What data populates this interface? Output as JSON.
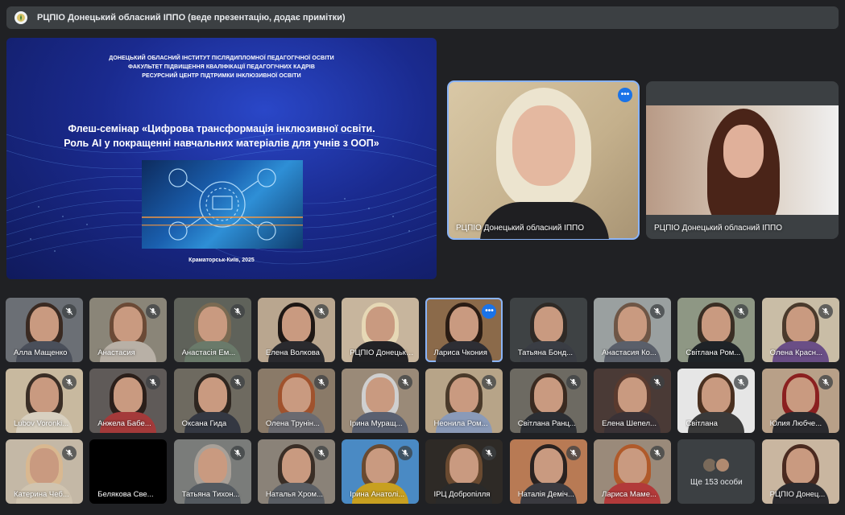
{
  "topbar": {
    "title": "РЦПІО Донецький обласний ІППО (веде презентацію, додає примітки)",
    "logo_icon": "org-logo-icon"
  },
  "slide": {
    "header_lines": [
      "ДОНЕЦЬКИЙ ОБЛАСНИЙ ІНСТИТУТ ПІСЛЯДИПЛОМНОЇ ПЕДАГОГІЧНОЇ ОСВІТИ",
      "ФАКУЛЬТЕТ ПІДВИЩЕННЯ КВАЛІФІКАЦІЇ ПЕДАГОГІЧНИХ КАДРІВ",
      "РЕСУРСНИЙ ЦЕНТР ПІДТРИМКИ ІНКЛЮЗИВНОЇ ОСВІТИ"
    ],
    "heading_lines": [
      "Флеш-семінар «Цифрова трансформація інклюзивної освіти.",
      "Роль AI у покращенні навчальних матеріалів для учнів з ООП»"
    ],
    "footer": "Краматорськ-Київ, 2025"
  },
  "main_tiles": [
    {
      "label": "РЦПІО Донецький обласний ІППО",
      "active": true
    },
    {
      "label": "РЦПІО Донецький обласний ІППО",
      "active": false
    }
  ],
  "participants": [
    {
      "name": "Алла Мащенко",
      "muted": true,
      "bg": "#6b6f75",
      "hair": "#3a2a22",
      "shirt": "#4a4f5a"
    },
    {
      "name": "Анастасия",
      "muted": true,
      "bg": "#8a8578",
      "hair": "#6b4a36",
      "shirt": "#b8b0a6"
    },
    {
      "name": "Анастасія Ем...",
      "muted": true,
      "bg": "#5f625a",
      "hair": "#7a6a52",
      "shirt": "#6a7a6a"
    },
    {
      "name": "Елена Волкова",
      "muted": true,
      "bg": "#b9a68f",
      "hair": "#1e1714",
      "shirt": "#2a2a2e"
    },
    {
      "name": "РЦПІО Донецький ...",
      "muted": false,
      "bg": "#c7b59d",
      "hair": "#e6d8b5",
      "shirt": "#222225"
    },
    {
      "name": "Лариса Чкония",
      "muted": false,
      "active": true,
      "bg": "#8b6a4a",
      "hair": "#2a1c14",
      "shirt": "#2e2e34"
    },
    {
      "name": "Татьяна Бонд...",
      "muted": false,
      "bg": "#3e4244",
      "hair": "#2f2a26",
      "shirt": "#3a3d44"
    },
    {
      "name": "Анастасия Ко...",
      "muted": true,
      "bg": "#9aa0a0",
      "hair": "#6e5646",
      "shirt": "#5a5f6a"
    },
    {
      "name": "Світлана Ром...",
      "muted": true,
      "bg": "#8e9784",
      "hair": "#3a2e24",
      "shirt": "#1f2327"
    },
    {
      "name": "Олена Красн...",
      "muted": true,
      "bg": "#c9bda6",
      "hair": "#4a3a2c",
      "shirt": "#6a4e86"
    },
    {
      "name": "Lubov Voronki...",
      "muted": true,
      "bg": "#c8b99f",
      "hair": "#3a2e26",
      "shirt": "#d8d0c0"
    },
    {
      "name": "Анжела Бабе...",
      "muted": true,
      "bg": "#5f5a58",
      "hair": "#2b1f1a",
      "shirt": "#a43a3a"
    },
    {
      "name": "Оксана Гида",
      "muted": true,
      "bg": "#6e6a60",
      "hair": "#2e2620",
      "shirt": "#343842"
    },
    {
      "name": "Олена Трунін...",
      "muted": true,
      "bg": "#8a7a68",
      "hair": "#a0522d",
      "shirt": "#6a6a70"
    },
    {
      "name": "Ірина Муращ...",
      "muted": true,
      "bg": "#9a8a78",
      "hair": "#cfcfcf",
      "shirt": "#5a6070"
    },
    {
      "name": "Неонила Ром...",
      "muted": true,
      "bg": "#b7a488",
      "hair": "#4a3a2a",
      "shirt": "#8a9ab8"
    },
    {
      "name": "Світлана Ранц...",
      "muted": true,
      "bg": "#6d6a62",
      "hair": "#3a2a20",
      "shirt": "#2b2e33"
    },
    {
      "name": "Елена Шепел...",
      "muted": true,
      "bg": "#4a3a36",
      "hair": "#5a3a2e",
      "shirt": "#3a3236"
    },
    {
      "name": "Світлана",
      "muted": true,
      "bg": "#e6e6e6",
      "hair": "#4a3020",
      "shirt": "#3a3a3a"
    },
    {
      "name": "Юлия Любче...",
      "muted": true,
      "bg": "#b8a088",
      "hair": "#8b2020",
      "shirt": "#2a2a2e"
    },
    {
      "name": "Катерина Чеб...",
      "muted": true,
      "bg": "#c4b8a6",
      "hair": "#d9b890",
      "shirt": "#d0c4b0"
    },
    {
      "name": "Белякова Све...",
      "muted": false,
      "bg": "#000000",
      "hair": "#000000",
      "shirt": "#000000",
      "video_off": true
    },
    {
      "name": "Татьяна Тихон...",
      "muted": true,
      "bg": "#7a7c7a",
      "hair": "#a8a098",
      "shirt": "#545a60"
    },
    {
      "name": "Наталья Хром...",
      "muted": true,
      "bg": "#8a8278",
      "hair": "#3a2e26",
      "shirt": "#5a5e64"
    },
    {
      "name": "Ірина Анатолі...",
      "muted": true,
      "bg": "#4a8ac4",
      "hair": "#6a4a30",
      "shirt": "#c8a020"
    },
    {
      "name": "ІРЦ Добропілля",
      "muted": true,
      "bg": "#2e2a26",
      "hair": "#6a4a30",
      "shirt": "#2a2a2a"
    },
    {
      "name": "Наталія Деміч...",
      "muted": true,
      "bg": "#b87a54",
      "hair": "#2a2220",
      "shirt": "#3a3a40"
    },
    {
      "name": "Лариса Маме...",
      "muted": true,
      "bg": "#9a8a7a",
      "hair": "#b05a2a",
      "shirt": "#b23a3a"
    }
  ],
  "more": {
    "label": "Ще 153 особи",
    "avatar_colors": [
      "#7a6a5a",
      "#b08a70"
    ]
  },
  "last_tile": {
    "name": "РЦПІО Донец...",
    "bg": "#c9b6a0",
    "hair": "#4a2a20",
    "shirt": "#2a2a2e"
  },
  "colors": {
    "active_outline": "#8ab4f8",
    "dots_button": "#1a73e8",
    "background": "#202124",
    "tile": "#3c4043"
  }
}
